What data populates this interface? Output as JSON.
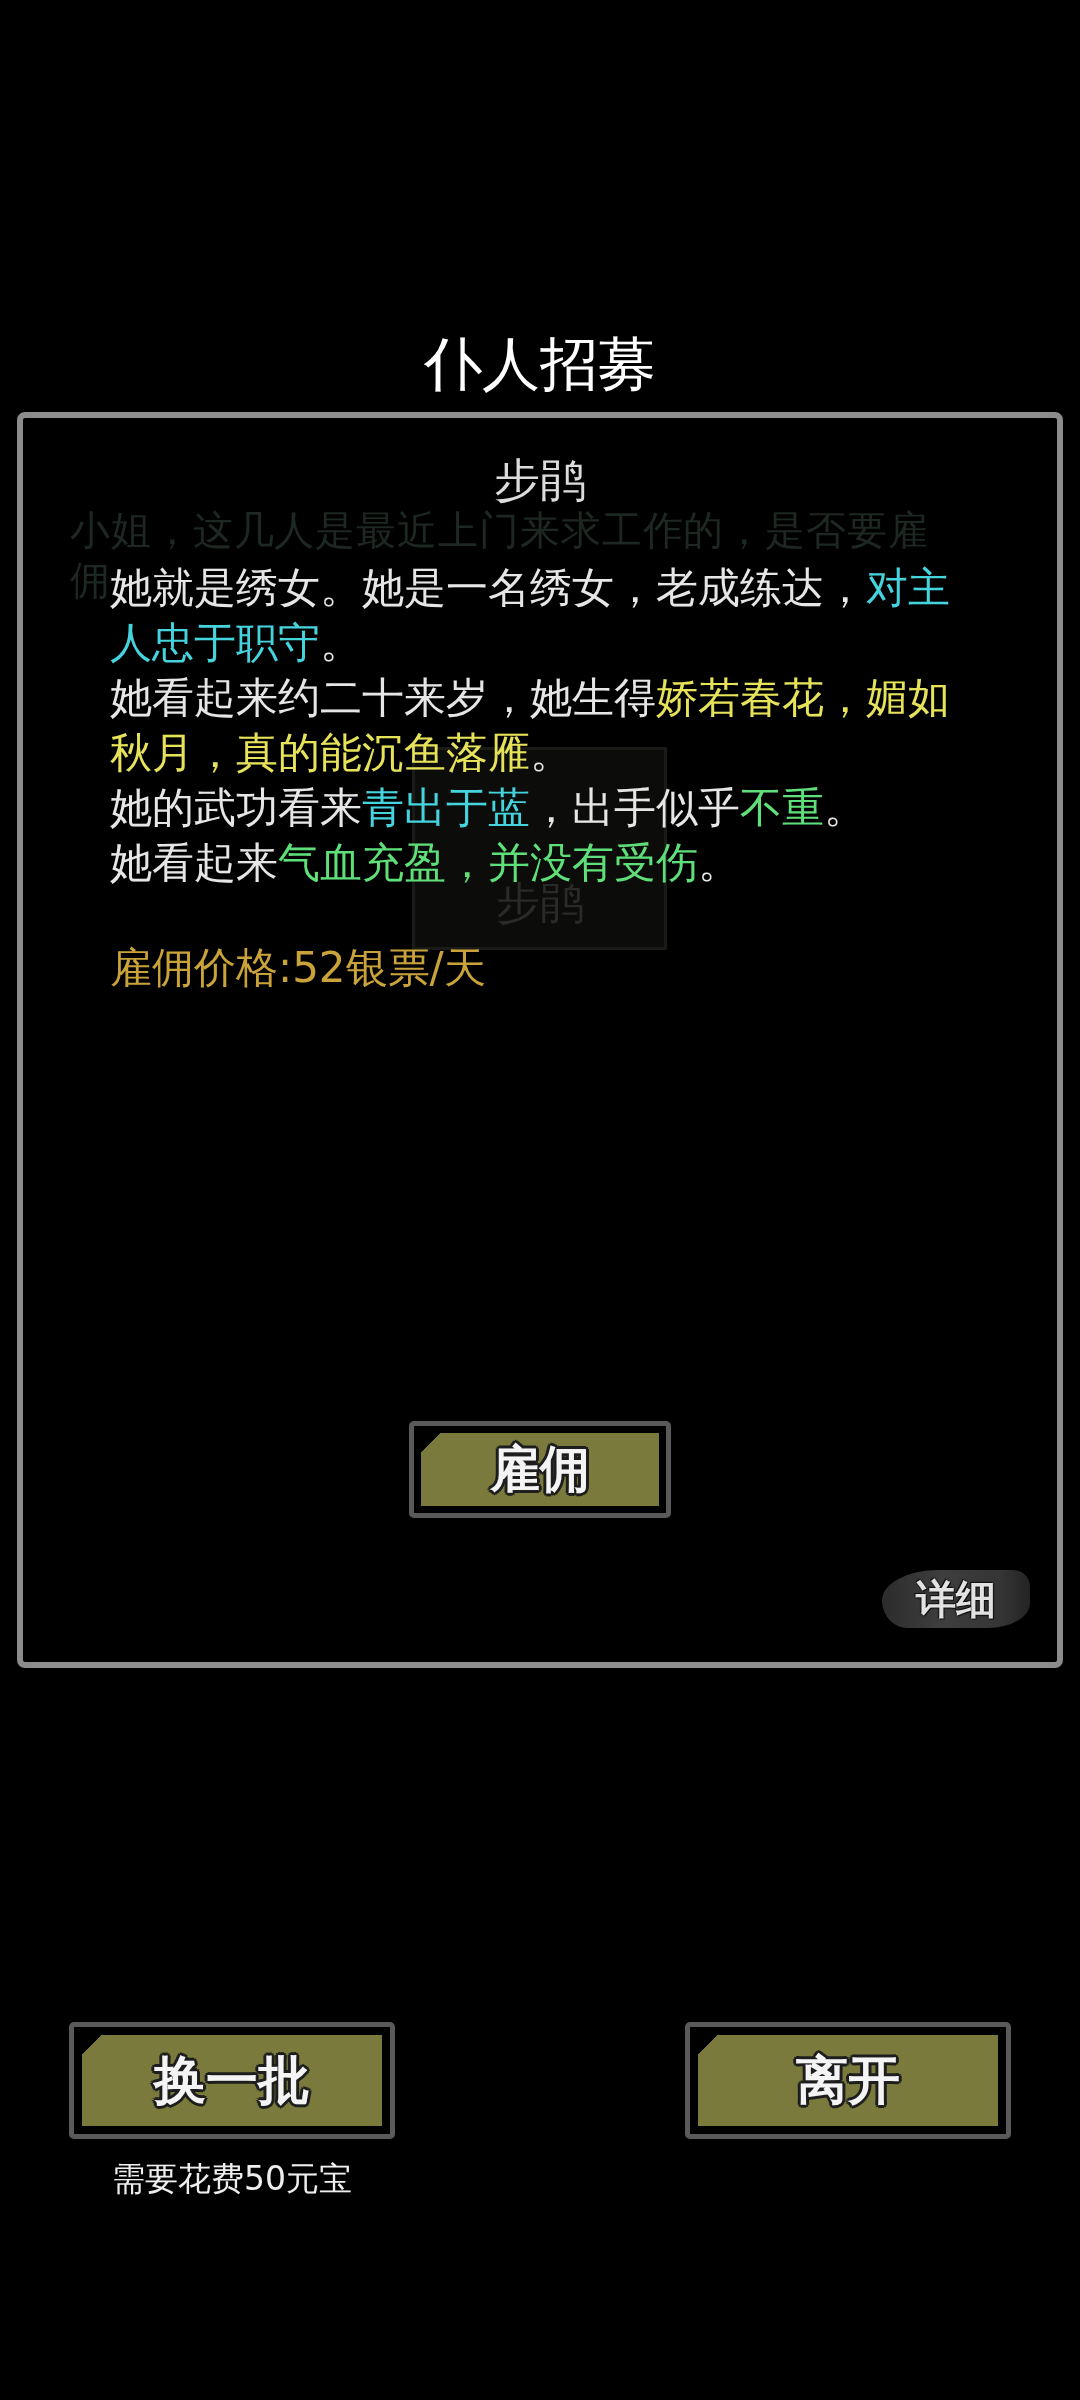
{
  "title": "仆人招募",
  "background": {
    "prompt_lines": [
      "小姐，这几人是最近上门来求工作的，是否要雇",
      "佣"
    ],
    "card_name": "步鹃"
  },
  "dialog": {
    "name": "步鹃",
    "description": [
      {
        "segments": [
          {
            "text": "她就是绣女。她是一名绣女，老成练达，"
          },
          {
            "text": "对主人忠于职守",
            "color": "#45d3dd"
          },
          {
            "text": "。"
          }
        ]
      },
      {
        "segments": [
          {
            "text": "她看起来约二十来岁，她生得"
          },
          {
            "text": "娇若春花，媚如秋月，真的能沉鱼落雁",
            "color": "#e6e35a"
          },
          {
            "text": "。"
          }
        ]
      },
      {
        "segments": [
          {
            "text": "她的武功看来"
          },
          {
            "text": "青出于蓝",
            "color": "#45d3dd"
          },
          {
            "text": "，出手似乎"
          },
          {
            "text": "不重",
            "color": "#5fdf7a"
          },
          {
            "text": "。"
          }
        ]
      },
      {
        "segments": [
          {
            "text": "她看起来"
          },
          {
            "text": "气血充盈，并没有受伤",
            "color": "#5fdf7a"
          },
          {
            "text": "。"
          }
        ]
      }
    ],
    "price": "雇佣价格:52银票/天",
    "hire_button": "雇佣",
    "details_button": "详细"
  },
  "actions": [
    {
      "label": "换一批",
      "note": "需要花费50元宝"
    },
    {
      "label": "离开"
    }
  ]
}
